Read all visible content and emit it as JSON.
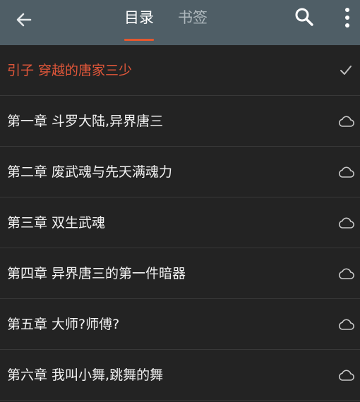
{
  "header": {
    "tabs": [
      {
        "label": "目录",
        "active": true
      },
      {
        "label": "书签",
        "active": false
      }
    ],
    "accent_color": "#e4572e",
    "bar_color": "#4f5e66",
    "icons": [
      "back-arrow-icon",
      "search-icon",
      "more-vert-icon"
    ]
  },
  "chapters": [
    {
      "title": "引子 穿越的唐家三少",
      "status_icon": "check-icon",
      "current": true
    },
    {
      "title": "第一章 斗罗大陆,异界唐三",
      "status_icon": "cloud-icon",
      "current": false
    },
    {
      "title": "第二章 废武魂与先天满魂力",
      "status_icon": "cloud-icon",
      "current": false
    },
    {
      "title": "第三章 双生武魂",
      "status_icon": "cloud-icon",
      "current": false
    },
    {
      "title": "第四章 异界唐三的第一件暗器",
      "status_icon": "cloud-icon",
      "current": false
    },
    {
      "title": "第五章 大师?师傅?",
      "status_icon": "cloud-icon",
      "current": false
    },
    {
      "title": "第六章 我叫小舞,跳舞的舞",
      "status_icon": "cloud-icon",
      "current": false
    }
  ]
}
